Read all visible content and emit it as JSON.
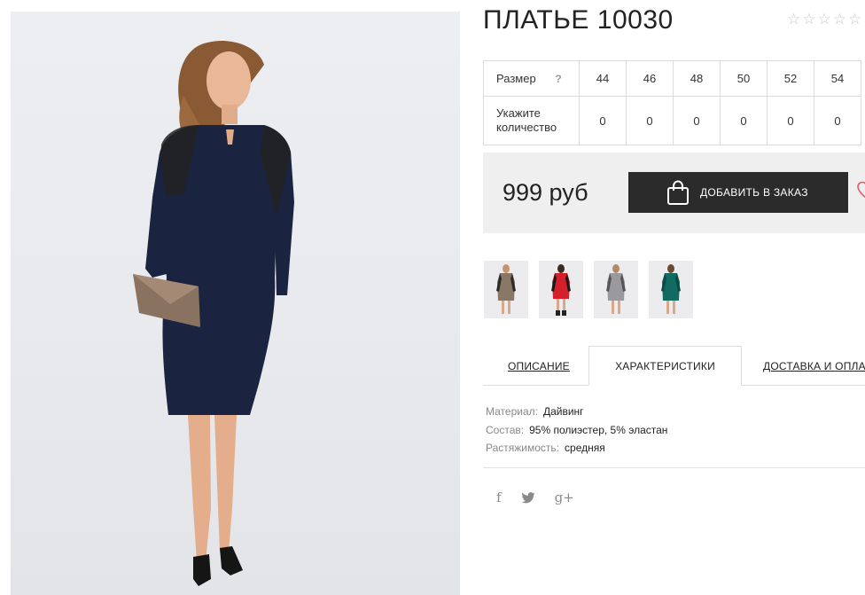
{
  "product": {
    "title": "ПЛАТЬЕ 10030",
    "rating_stars": 5,
    "rating_value": 0
  },
  "sizes": {
    "label": "Размер",
    "help": "?",
    "quantity_label_line1": "Укажите",
    "quantity_label_line2": "количество",
    "values": [
      "44",
      "46",
      "48",
      "50",
      "52",
      "54"
    ],
    "quantities": [
      "0",
      "0",
      "0",
      "0",
      "0",
      "0"
    ]
  },
  "price": {
    "amount": "999 руб",
    "add_button": "ДОБАВИТЬ В ЗАКАЗ"
  },
  "thumbnails": [
    {
      "icon": "dress-thumbnail-beige",
      "color": "#8a7866"
    },
    {
      "icon": "dress-thumbnail-red",
      "color": "#d4202a"
    },
    {
      "icon": "dress-thumbnail-grey",
      "color": "#9a9a9e"
    },
    {
      "icon": "dress-thumbnail-green",
      "color": "#126b62"
    }
  ],
  "tabs": {
    "description": "ОПИСАНИЕ",
    "characteristics": "ХАРАКТЕРИСТИКИ",
    "delivery": "ДОСТАВКА И ОПЛАТА"
  },
  "specs": [
    {
      "key": "Материал:",
      "value": "Дайвинг"
    },
    {
      "key": "Состав:",
      "value": "95% полиэстер, 5% эластан"
    },
    {
      "key": "Растяжимость:",
      "value": "средняя"
    }
  ],
  "social": {
    "facebook": "f",
    "twitter": "twitter-icon",
    "googleplus": "g+"
  },
  "colors": {
    "dress": "#1a2340",
    "button_bg": "#2b2b2b",
    "price_bg": "#efefef",
    "heart": "#e35a6a"
  }
}
